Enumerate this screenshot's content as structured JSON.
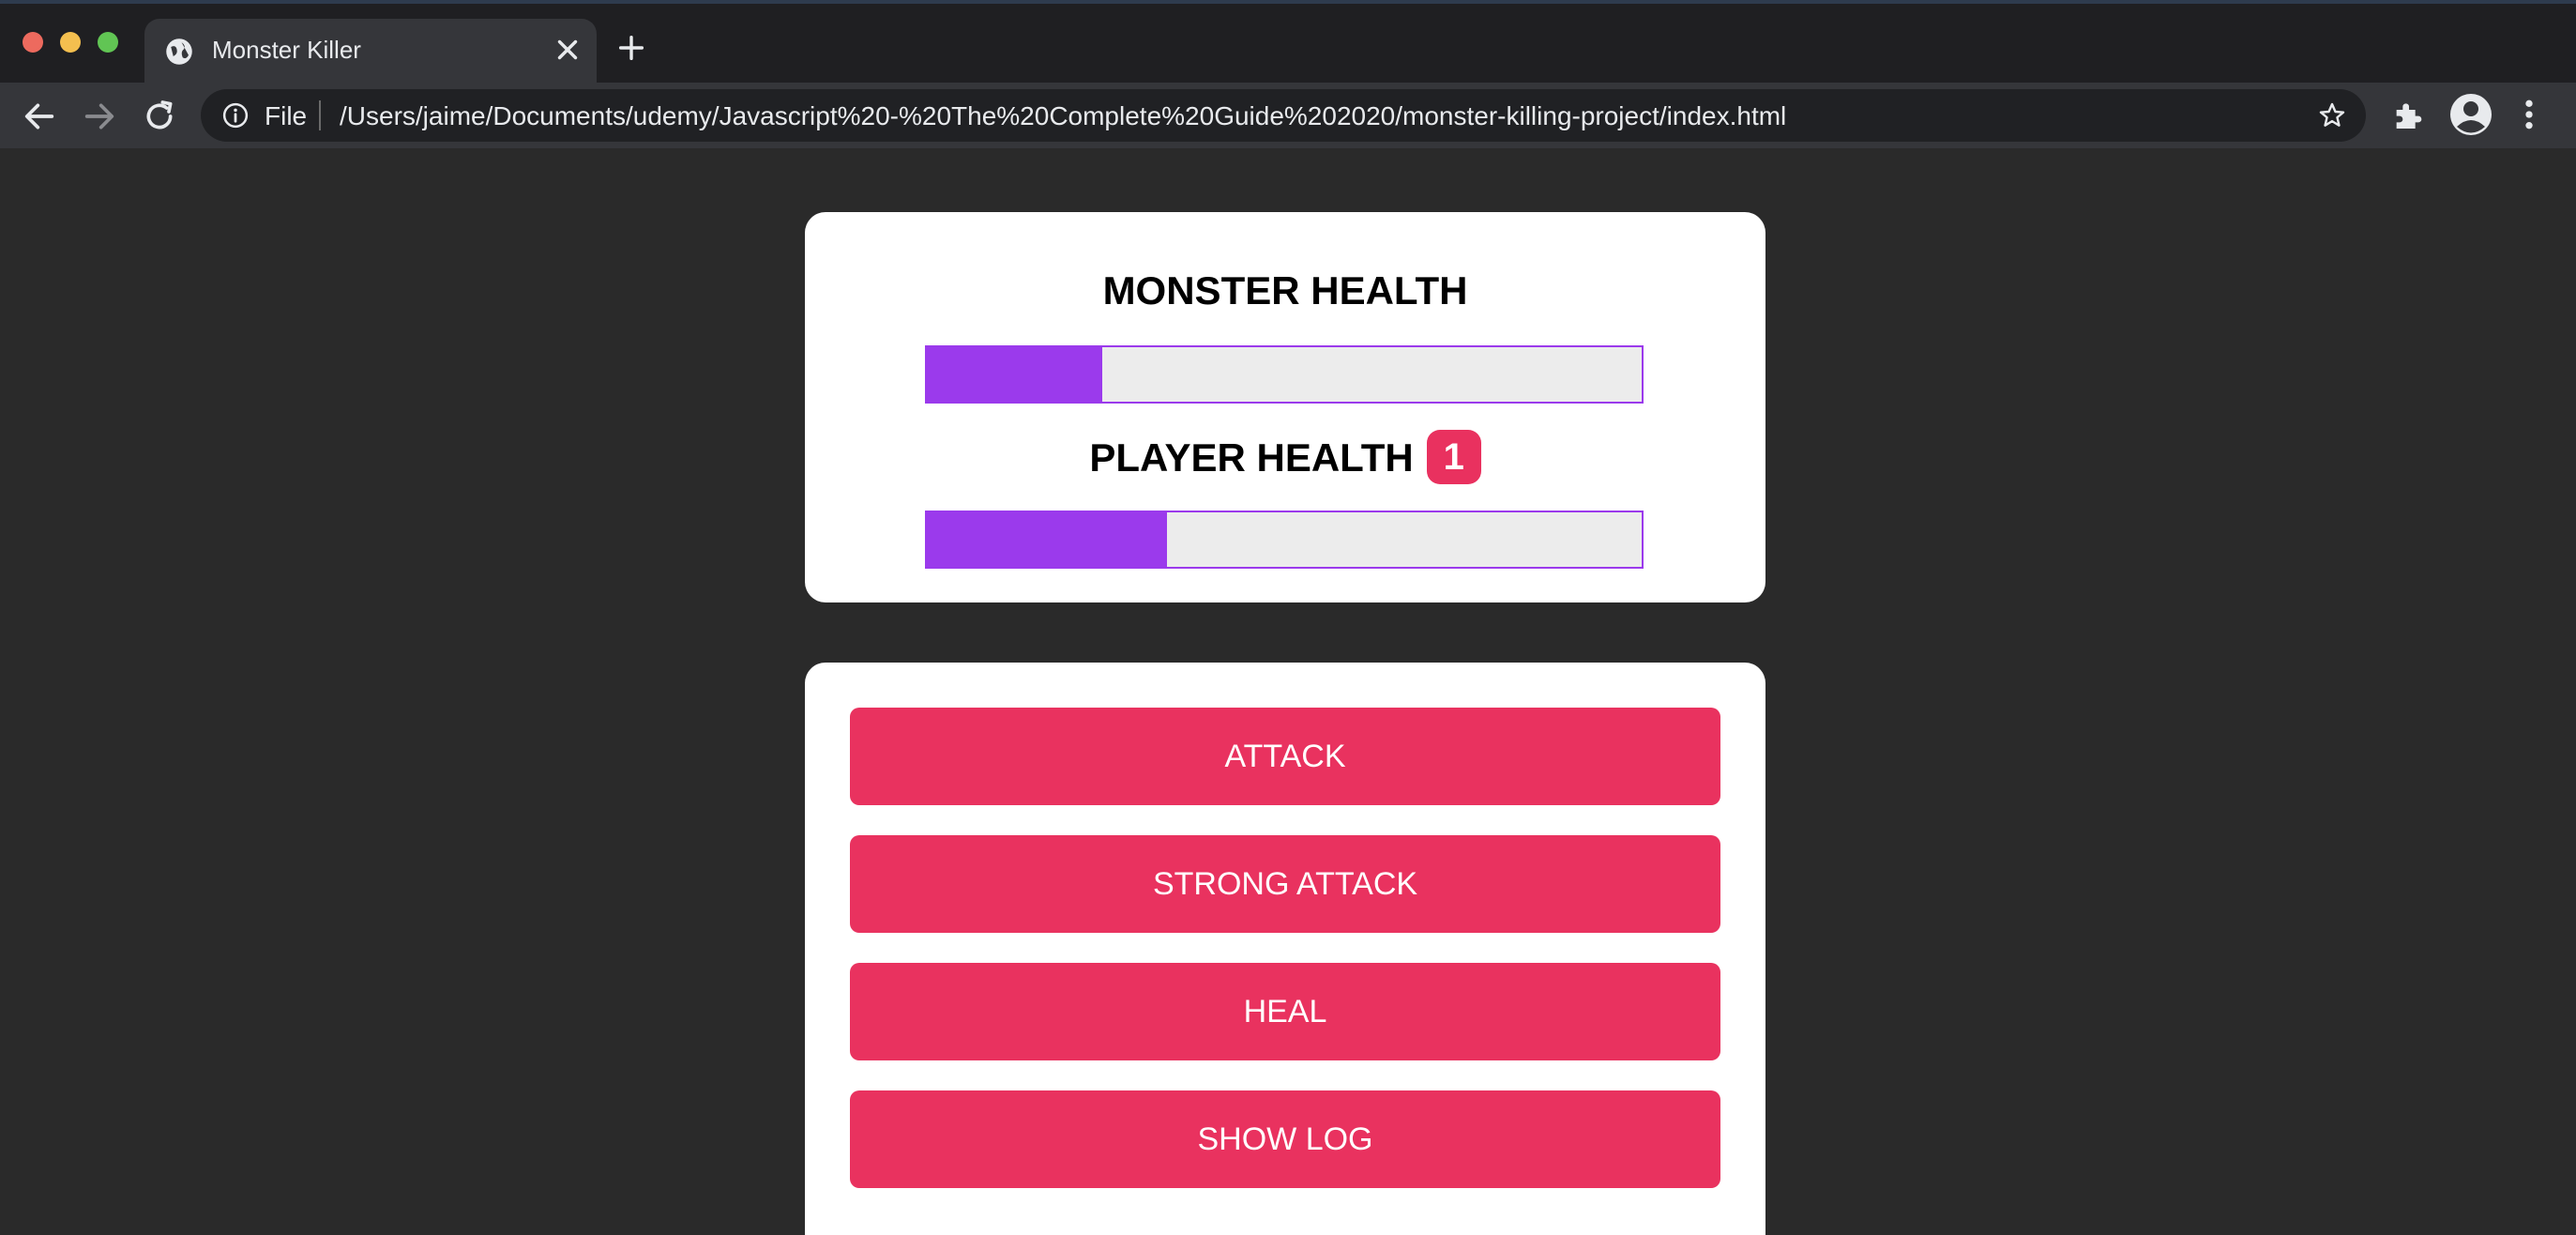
{
  "browser": {
    "tab_title": "Monster Killer",
    "file_label": "File",
    "url": "/Users/jaime/Documents/udemy/Javascript%20-%20The%20Complete%20Guide%202020/monster-killing-project/index.html",
    "icons": [
      "globe-icon",
      "close-icon",
      "plus-icon",
      "back-arrow-icon",
      "forward-arrow-icon",
      "reload-icon",
      "info-icon",
      "star-icon",
      "puzzle-icon",
      "profile-icon",
      "more-vert-icon"
    ]
  },
  "game": {
    "monster_health_label": "MONSTER HEALTH",
    "player_health_label": "PLAYER HEALTH",
    "bonus_life": "1",
    "monster_health_percent": 24.5,
    "player_health_percent": 33.6,
    "colors": {
      "bar": "#9b3aec",
      "button": "#e9325f",
      "background": "#2a2a2a"
    }
  },
  "controls": {
    "attack": "ATTACK",
    "strong_attack": "STRONG ATTACK",
    "heal": "HEAL",
    "show_log": "SHOW LOG"
  }
}
